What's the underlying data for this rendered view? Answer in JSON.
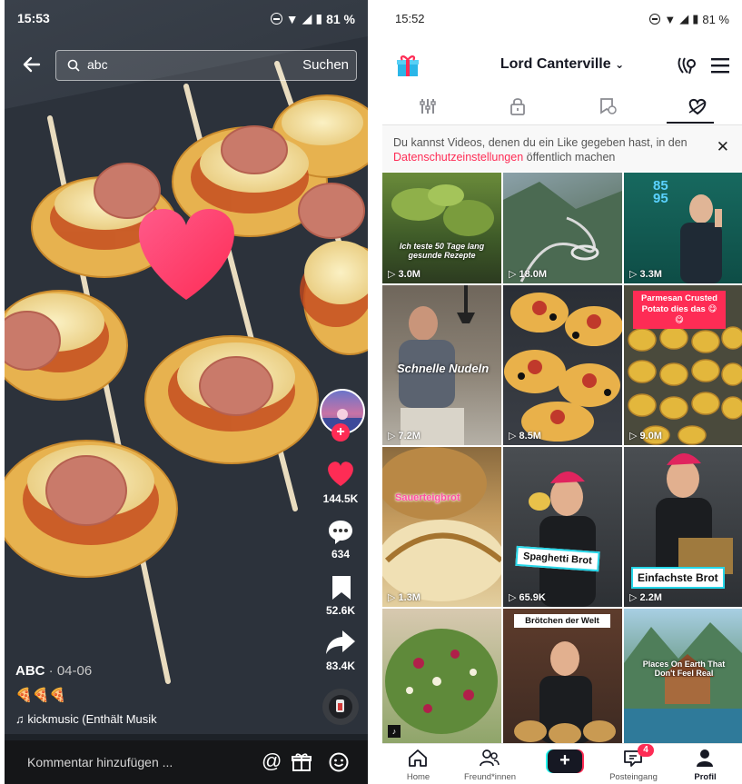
{
  "left": {
    "status_time": "15:53",
    "status_battery": "81 %",
    "search_query": "abc",
    "search_button": "Suchen",
    "likes": "144.5K",
    "comments": "634",
    "saves": "52.6K",
    "shares": "83.4K",
    "author": "ABC",
    "date": "· 04-06",
    "caption_emoji": "🍕🍕🍕",
    "music_text": "♫ kickmusic (Enthält Musik",
    "comment_placeholder": "Kommentar hinzufügen ...",
    "colors": {
      "heart": "#fe2c55",
      "bar": "#151618"
    }
  },
  "right": {
    "status_time": "15:52",
    "status_battery": "81 %",
    "username": "Lord Canterville",
    "notice_text": "Du kannst Videos, denen du ein Like gegeben hast, in den",
    "notice_link": "Datenschutzeinstellungen",
    "notice_suffix": " öffentlich machen",
    "grid": [
      {
        "views": "3.0M",
        "overlay": "Ich teste 50 Tage lang gesunde Rezepte"
      },
      {
        "views": "18.0M",
        "overlay": ""
      },
      {
        "views": "3.3M",
        "overlay": "85 95"
      },
      {
        "views": "7.2M",
        "overlay": "Schnelle Nudeln"
      },
      {
        "views": "8.5M",
        "overlay": ""
      },
      {
        "views": "9.0M",
        "overlay": "Parmesan Crusted Potato dies das 😋😋"
      },
      {
        "views": "1.3M",
        "overlay": "Sauerteigbrot"
      },
      {
        "views": "65.9K",
        "overlay": "Spaghetti Brot"
      },
      {
        "views": "2.2M",
        "overlay": "Einfachste Brot"
      },
      {
        "views": "",
        "overlay": ""
      },
      {
        "views": "",
        "overlay": "Brötchen der Welt"
      },
      {
        "views": "",
        "overlay": "Places On Earth That Don't Feel Real"
      }
    ],
    "nav": [
      {
        "label": "Home",
        "icon": "home-icon"
      },
      {
        "label": "Freund*innen",
        "icon": "friends-icon"
      },
      {
        "label": "+",
        "icon": "create-plus-icon"
      },
      {
        "label": "Posteingang",
        "icon": "inbox-icon",
        "badge": "4"
      },
      {
        "label": "Profil",
        "icon": "profile-icon"
      }
    ],
    "colors": {
      "accent": "#fe2c55",
      "text": "#161823"
    }
  }
}
